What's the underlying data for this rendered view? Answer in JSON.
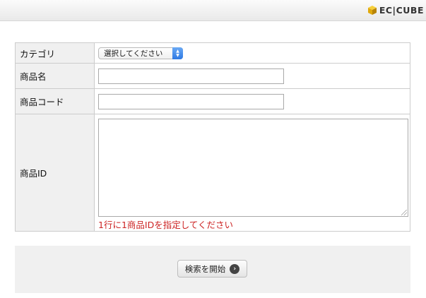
{
  "header": {
    "logo_text": "EC|CUBE"
  },
  "form": {
    "category_label": "カテゴリ",
    "category_selected": "選択してください",
    "product_name_label": "商品名",
    "product_name_value": "",
    "product_code_label": "商品コード",
    "product_code_value": "",
    "product_id_label": "商品ID",
    "product_id_value": "",
    "product_id_hint": "1行に1商品IDを指定してください"
  },
  "actions": {
    "search_label": "検索を開始",
    "search_icon": "chevron-right-circle-icon"
  },
  "colors": {
    "hint": "#cc2222",
    "label_bg": "#f0f0f0",
    "select_arrow": "#2e79e3",
    "logo_accent": "#f2b90f"
  }
}
